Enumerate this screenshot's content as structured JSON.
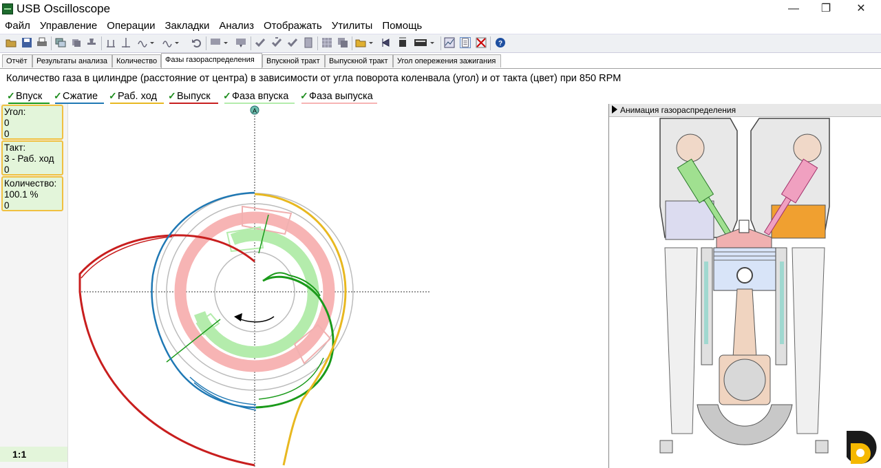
{
  "window": {
    "title": "USB Oscilloscope",
    "controls": {
      "minimize": "—",
      "maximize": "❐",
      "close": "✕"
    }
  },
  "menu": [
    "Файл",
    "Управление",
    "Операции",
    "Закладки",
    "Анализ",
    "Отображать",
    "Утилиты",
    "Помощь"
  ],
  "toolbar": {
    "icons": [
      "open-icon",
      "save-icon",
      "print-icon",
      "copy-screen-icon",
      "stack-icon",
      "stamp-icon",
      "cursor-icon",
      "wave-dropdown-icon",
      "wave2-dropdown-icon",
      "undo-icon",
      "display-dropdown-icon",
      "display2-icon",
      "check-icon",
      "check2-icon",
      "check3-icon",
      "doc-icon",
      "grid-icon",
      "grid2-icon",
      "folder-dropdown-icon",
      "data-icon",
      "stop-icon",
      "module-dropdown-icon",
      "chart-icon",
      "notes-icon",
      "delete-icon",
      "help-icon"
    ]
  },
  "tabs": [
    {
      "label": "Отчёт",
      "active": false
    },
    {
      "label": "Результаты анализа",
      "active": false
    },
    {
      "label": "Количество",
      "active": false
    },
    {
      "label": "Фазы газораспределения",
      "active": true
    },
    {
      "label": "Впускной тракт",
      "active": false
    },
    {
      "label": "Выпускной тракт",
      "active": false
    },
    {
      "label": "Угол опережения зажигания",
      "active": false
    }
  ],
  "description": "Количество газа в цилиндре (расстояние от центра) в зависимости от угла поворота коленвала (угол) и от такта (цвет) при 850 RPM",
  "legend": [
    {
      "label": "Впуск",
      "color": "#1a9a1a",
      "checked": true
    },
    {
      "label": "Сжатие",
      "color": "#1f78b4",
      "checked": true
    },
    {
      "label": "Раб. ход",
      "color": "#e8b820",
      "checked": true
    },
    {
      "label": "Выпуск",
      "color": "#c81e1e",
      "checked": true
    },
    {
      "label": "Фаза впуска",
      "color": "#a8e8a0",
      "checked": true
    },
    {
      "label": "Фаза выпуска",
      "color": "#f4a8a8",
      "checked": true
    }
  ],
  "info": {
    "angle": {
      "label": "Угол:",
      "line1": "0",
      "line2": "0"
    },
    "stroke": {
      "label": "Такт:",
      "line1": "3 - Раб. ход",
      "line2": "0"
    },
    "amount": {
      "label": "Количество:",
      "line1": "100.1 %",
      "line2": "0"
    }
  },
  "scale_label": "1:1",
  "marker_label": "A",
  "animation_panel": {
    "title": "Анимация газораспределения"
  },
  "colors": {
    "intake": "#1a9a1a",
    "compression": "#1f78b4",
    "power": "#e8b820",
    "exhaust": "#c81e1e",
    "intake_phase": "#b4ecac",
    "exhaust_phase": "#f7b4b4"
  }
}
